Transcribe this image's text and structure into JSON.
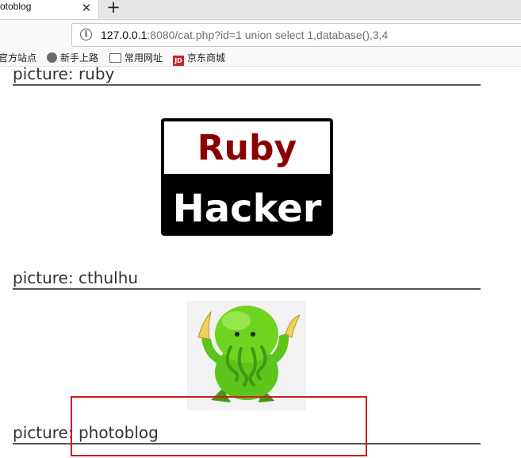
{
  "browser": {
    "tab_title": "otoblog",
    "close_glyph": "✕",
    "newtab_glyph": "+",
    "url_host": "127.0.0.1",
    "url_rest": ":8080/cat.php?id=1 union select 1,database(),3,4",
    "info_glyph": "i",
    "bookmarks": [
      {
        "label": "官方站点",
        "icon": "none"
      },
      {
        "label": "新手上路",
        "icon": "globe-icon"
      },
      {
        "label": "常用网址",
        "icon": "folder-icon"
      },
      {
        "label": "京东商城",
        "icon": "jd-icon"
      }
    ],
    "jd_glyph": "JD"
  },
  "page": {
    "pictures": [
      {
        "title": "picture: ruby",
        "image_text_top": "Ruby",
        "image_text_bottom": "Hacker"
      },
      {
        "title": "picture: cthulhu"
      },
      {
        "title": "picture: photoblog"
      }
    ]
  },
  "colors": {
    "highlight_box": "#cf1b1b",
    "ruby_red": "#8b0000"
  }
}
